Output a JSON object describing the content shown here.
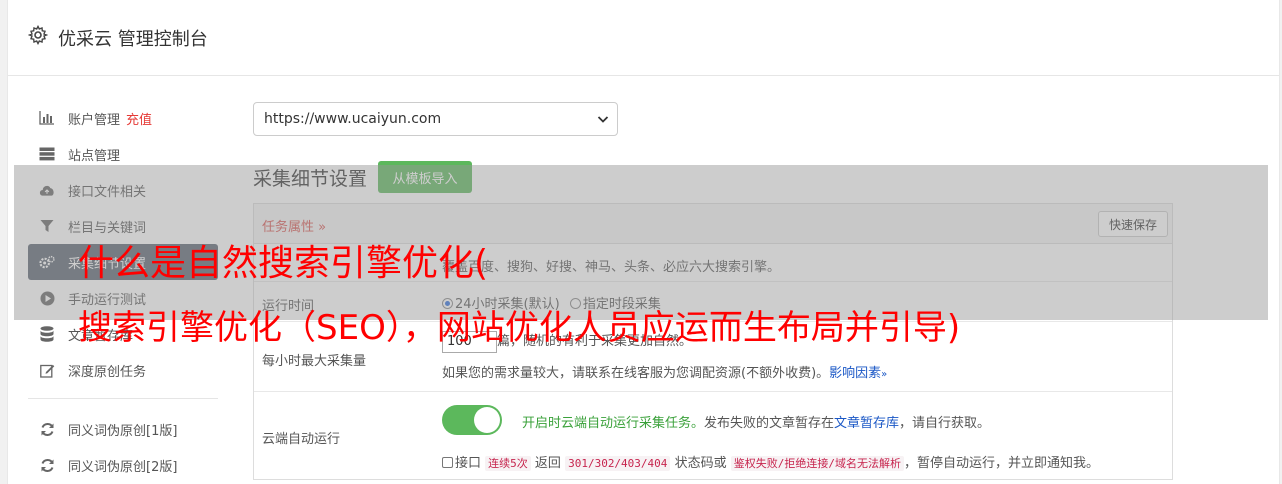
{
  "header": {
    "title": "优采云 管理控制台"
  },
  "sidebar": {
    "items": [
      {
        "label": "账户管理",
        "badge": "充值"
      },
      {
        "label": "站点管理"
      },
      {
        "label": "接口文件相关"
      },
      {
        "label": "栏目与关键词"
      },
      {
        "label": "采集细节设置"
      },
      {
        "label": "手动运行测试"
      },
      {
        "label": "文章暂存库"
      },
      {
        "label": "深度原创任务"
      }
    ],
    "items2": [
      {
        "label": "同义词伪原创[1版]"
      },
      {
        "label": "同义词伪原创[2版]"
      }
    ]
  },
  "main": {
    "site_select": "https://www.ucaiyun.com",
    "section_title": "采集细节设置",
    "import_button": "从模板导入",
    "panel_title": "任务属性",
    "quick_save": "快速保存",
    "rows": {
      "engines_text": "覆盖百度、搜狗、好搜、神马、头条、必应六大搜索引擎。",
      "run_time": {
        "label": "运行时间",
        "opt1": "24小时采集(默认)",
        "opt2": "指定时段采集"
      },
      "max_per_hour": {
        "label": "每小时最大采集量",
        "value": "100",
        "text1": "篇，随机的有利于采集更加自然。",
        "text2": "如果您的需求量较大，请联系在线客服为您调配资源(不额外收费)。",
        "link": "影响因素"
      },
      "cloud_run": {
        "label": "云端自动运行",
        "on_text": "开启时云端自动运行采集任务。",
        "desc1": "发布失败的文章暂存在",
        "link": "文章暂存库",
        "desc2": "，请自行获取。",
        "chk_label": "接口",
        "code1": "连续5次",
        "mid1": "返回",
        "code2": "301/302/403/404",
        "mid2": "状态码或",
        "code3": "鉴权失败/拒绝连接/域名无法解析",
        "tail": "，暂停自动运行，并立即通知我。"
      }
    }
  },
  "overlay": {
    "line1": "什么是自然搜索引擎优化(",
    "line2": "搜索引擎优化（SEO），网站优化人员应运而生布局并引导)"
  }
}
